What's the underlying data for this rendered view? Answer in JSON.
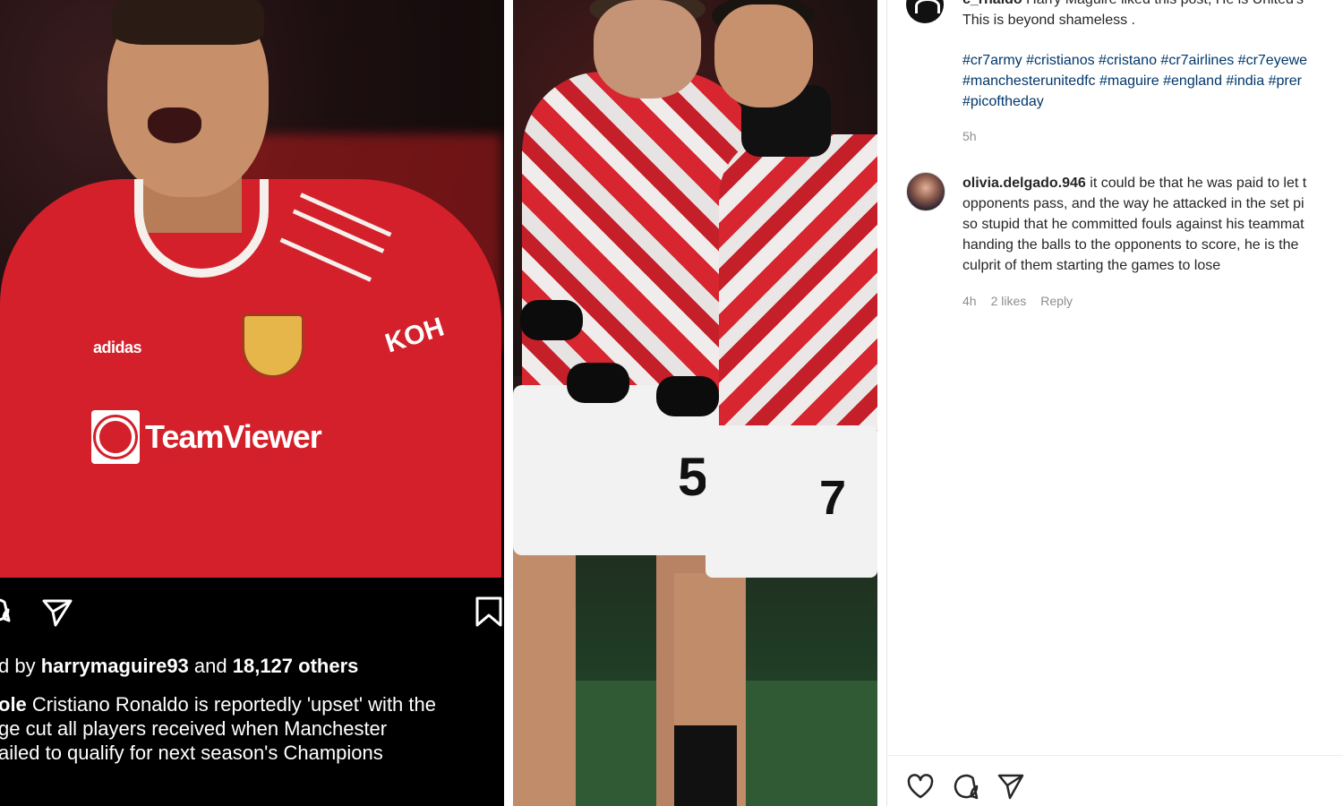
{
  "left_post": {
    "photo_sponsor": "TeamViewer",
    "photo_sleeve": "KOH",
    "photo_brand": "adidas",
    "liked_by_prefix": "d by ",
    "liked_by_user": "harrymaguire93",
    "liked_by_mid": " and ",
    "liked_by_count": "18,127 others",
    "caption_user": "ole",
    "caption_lines": [
      " Cristiano Ronaldo is reportedly 'upset' with the",
      "ge cut all players received when Manchester",
      "ailed to qualify for next season's Champions"
    ]
  },
  "middle_photo": {
    "number_left": "5",
    "number_right": "7"
  },
  "right_post": {
    "comment1": {
      "user": "c_rnaldo",
      "text_line1": " Harry Maguire liked this post, He is United's",
      "text_line2": "This is beyond shameless ."
    },
    "hashtag_lines": [
      "#cr7army #cristianos #cristano #cr7airlines #cr7eyewe",
      "#manchesterunitedfc #maguire #england #india #prer",
      "#picoftheday"
    ],
    "comment1_time": "5h",
    "comment2": {
      "user": "olivia.delgado.946",
      "line1": " it could be that he was paid to let t",
      "line2": "opponents pass, and the way he attacked in the set pi",
      "line3": "so stupid that he committed fouls against his teammat",
      "line4": "handing the balls to the opponents to score, he is the",
      "line5": "culprit of them starting the games to lose"
    },
    "comment2_time": "4h",
    "comment2_likes": "2 likes",
    "reply_label": "Reply"
  },
  "icons": {
    "heart": "heart-icon",
    "comment": "comment-icon",
    "share": "share-icon",
    "bookmark": "bookmark-icon"
  },
  "colors": {
    "link": "#00376b",
    "muted": "#8e8e8e",
    "text": "#262626"
  }
}
